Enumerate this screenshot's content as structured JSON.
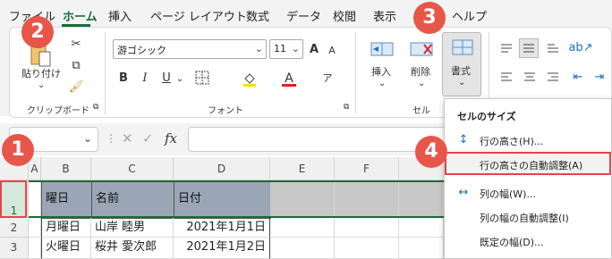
{
  "menu": {
    "tabs": [
      "ファイル",
      "ホーム",
      "挿入",
      "ページ レイアウト",
      "数式",
      "データ",
      "校閲",
      "表示",
      "ヘルプ"
    ],
    "active": "ホーム",
    "partial": "ル"
  },
  "ribbon": {
    "clipboard": {
      "paste_label": "貼り付け",
      "group": "クリップボード"
    },
    "font": {
      "name": "游ゴシック",
      "size": "11",
      "group": "フォント",
      "bold": "B",
      "italic": "I",
      "underline": "U",
      "color_a": "A",
      "grow": "A",
      "shrink": "A",
      "phonetic": "ア"
    },
    "cells": {
      "insert": "挿入",
      "delete": "削除",
      "format": "書式",
      "group": "セル"
    }
  },
  "formula_bar": {
    "fx": "fx"
  },
  "columns": [
    "A",
    "B",
    "C",
    "D",
    "E",
    "F"
  ],
  "rows": [
    "1",
    "2",
    "3"
  ],
  "table": {
    "header": [
      "曜日",
      "名前",
      "日付"
    ],
    "rows": [
      [
        "月曜日",
        "山岸 睦男",
        "2021年1月1日"
      ],
      [
        "火曜日",
        "桜井 愛次郎",
        "2021年1月2日"
      ]
    ]
  },
  "dropdown": {
    "heading": "セルのサイズ",
    "items": [
      "行の高さ(H)...",
      "行の高さの自動調整(A)",
      "列の幅(W)...",
      "列の幅の自動調整(I)",
      "既定の幅(D)..."
    ]
  },
  "badges": [
    "1",
    "2",
    "3",
    "4"
  ],
  "colors": {
    "accent": "#1b6b3a",
    "badge": "#e8564a",
    "highlight": "#e8434c",
    "header_fill": "#9aa6b6"
  }
}
